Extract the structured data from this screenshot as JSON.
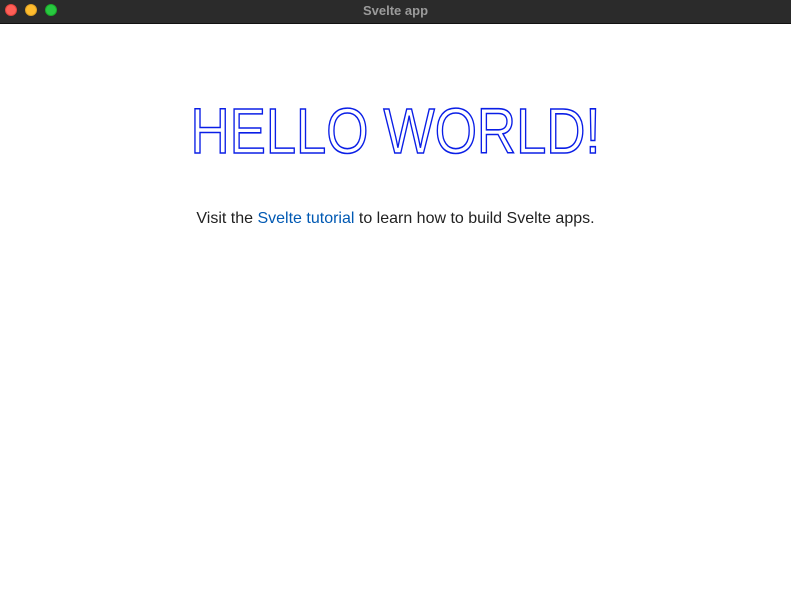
{
  "window": {
    "title": "Svelte app",
    "controls": {
      "close_color": "#fe5f57",
      "minimize_color": "#febc2e",
      "zoom_color": "#28c840"
    }
  },
  "main": {
    "heading": "HELLO WORLD!",
    "heading_color": "#0a1ee6",
    "paragraph": {
      "prefix": "Visit the ",
      "link_text": "Svelte tutorial",
      "suffix": " to learn how to build Svelte apps.",
      "link_color": "#0059b3"
    }
  }
}
